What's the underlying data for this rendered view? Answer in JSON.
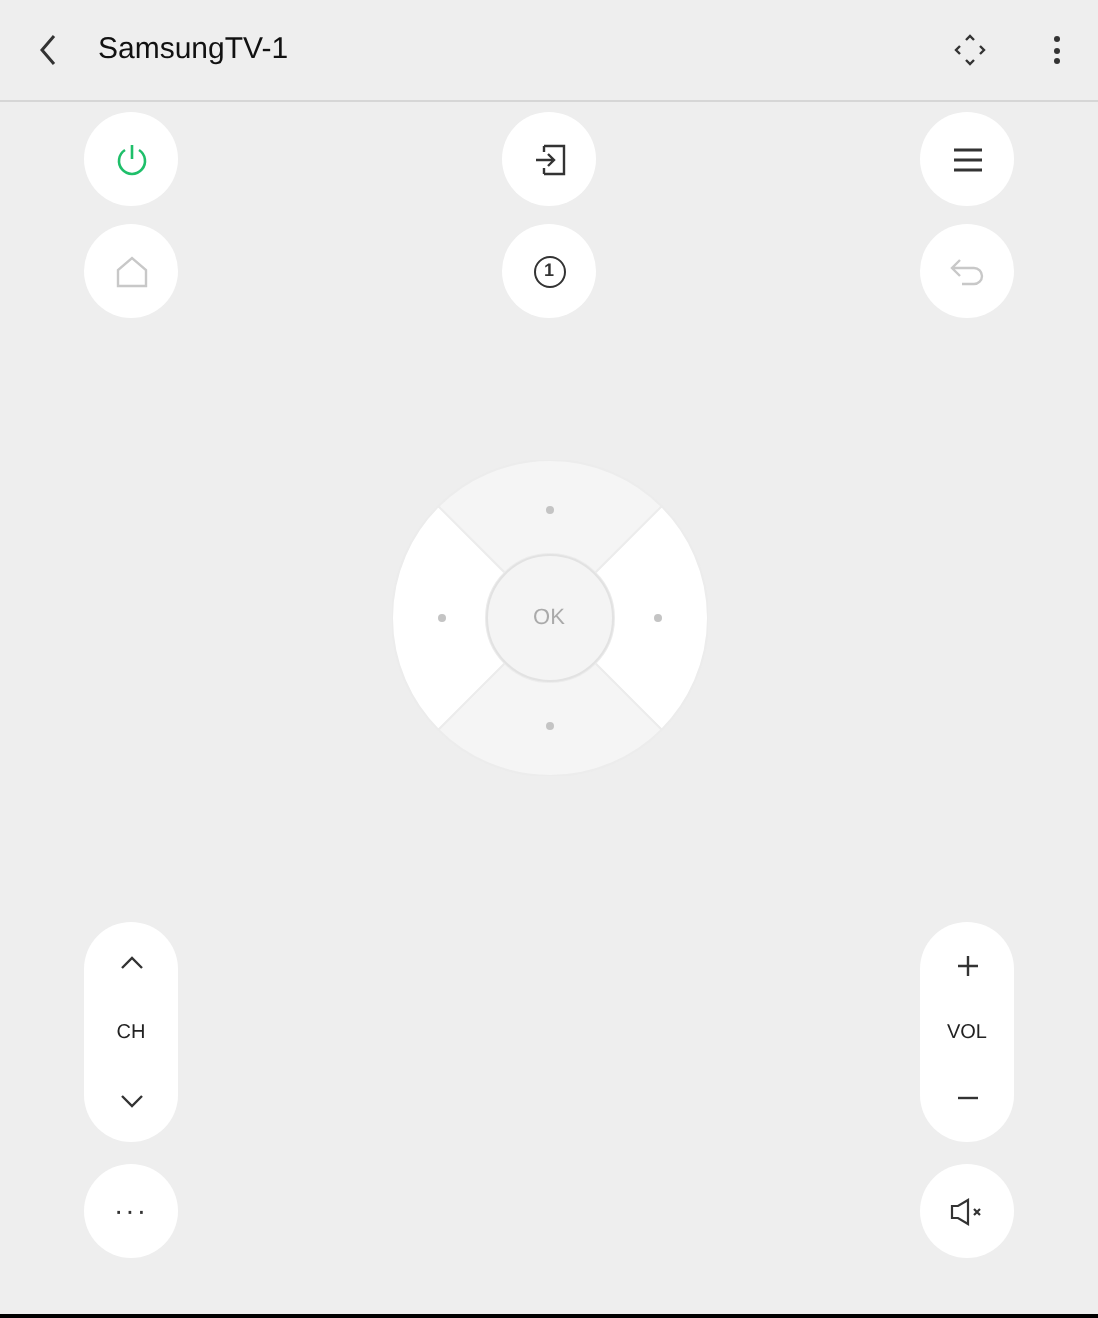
{
  "header": {
    "title": "SamsungTV-1"
  },
  "top_buttons": [
    {
      "kind": "power",
      "disabled": false
    },
    {
      "kind": "input",
      "disabled": false
    },
    {
      "kind": "menu",
      "disabled": false
    },
    {
      "kind": "home",
      "disabled": true
    },
    {
      "kind": "number",
      "label": "1",
      "disabled": false
    },
    {
      "kind": "back",
      "disabled": true
    }
  ],
  "dpad": {
    "ok_label": "OK"
  },
  "channel": {
    "label": "CH"
  },
  "volume": {
    "label": "VOL"
  },
  "more_button": {
    "label": "···"
  }
}
